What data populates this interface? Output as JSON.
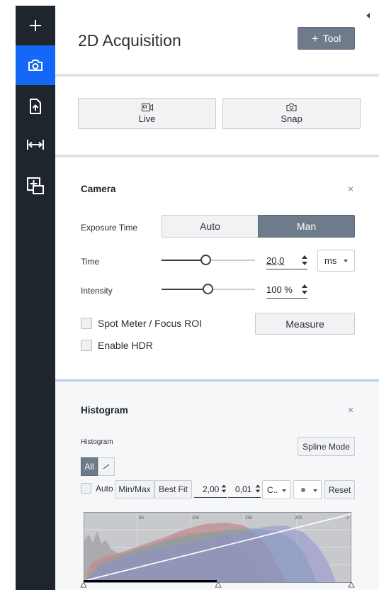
{
  "rail": {
    "items": [
      {
        "name": "add",
        "icon": "plus-icon",
        "active": false
      },
      {
        "name": "camera",
        "icon": "camera-icon",
        "active": true
      },
      {
        "name": "export",
        "icon": "file-upload-icon",
        "active": false
      },
      {
        "name": "measure",
        "icon": "width-arrows-icon",
        "active": false
      },
      {
        "name": "add-view",
        "icon": "add-frame-icon",
        "active": false
      }
    ],
    "colors": {
      "background": "#1f252c",
      "active": "#1468f5"
    }
  },
  "header": {
    "title": "2D Acquisition",
    "tool_button_label": "Tool"
  },
  "acquisition": {
    "live_label": "Live",
    "snap_label": "Snap"
  },
  "camera_card": {
    "title": "Camera",
    "close_glyph": "×",
    "exposure_label": "Exposure Time",
    "mode_auto": "Auto",
    "mode_man": "Man",
    "selected_mode": "Man",
    "time_label": "Time",
    "time_value": "20,0",
    "time_unit": "ms",
    "time_slider_level": 0.4,
    "intensity_label": "Intensity",
    "intensity_value": "100 %",
    "intensity_slider_level": 0.43,
    "spot_meter_label": "Spot Meter / Focus ROI",
    "enable_hdr_label": "Enable HDR",
    "measure_label": "Measure"
  },
  "histogram_card": {
    "title": "Histogram",
    "close_glyph": "×",
    "section_label": "Histogram",
    "spline_mode_label": "Spline Mode",
    "toggle_all": "All",
    "auto_label": "Auto",
    "min_max_label": "Min/Max",
    "best_fit_label": "Best Fit",
    "gamma_value": "2,00",
    "clip_value": "0,01",
    "channel_select": "C..",
    "reset_label": "Reset",
    "tick_labels": [
      "50",
      "100",
      "150",
      "200",
      "2"
    ]
  }
}
